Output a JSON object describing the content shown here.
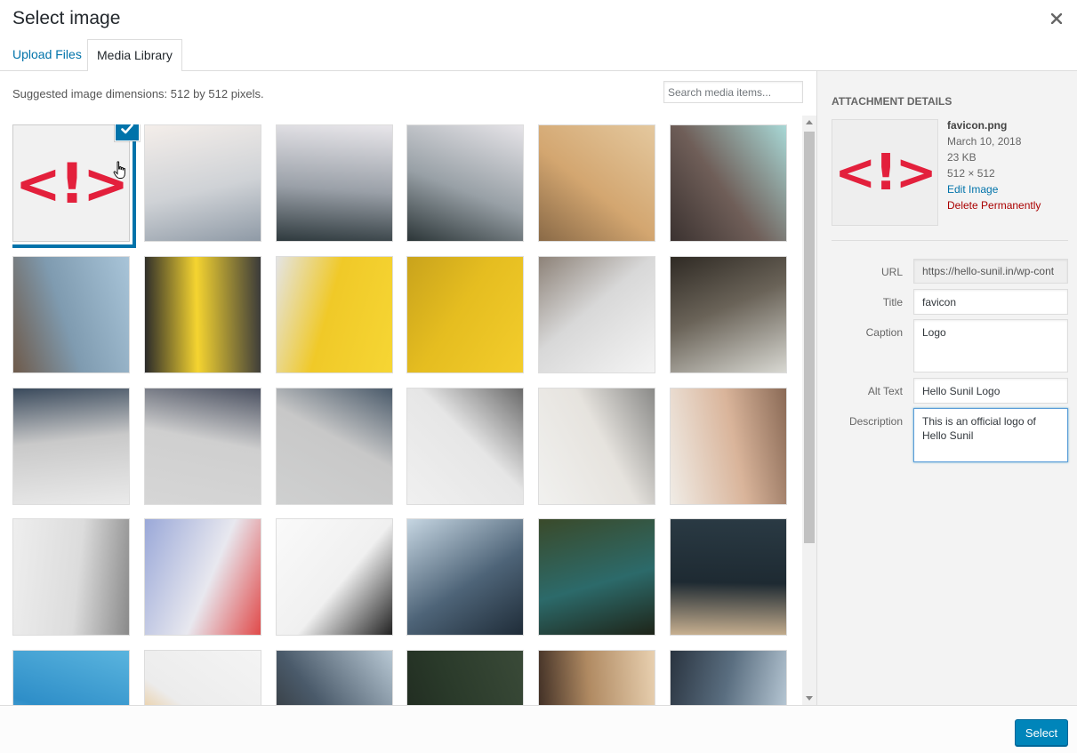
{
  "modal": {
    "title": "Select image",
    "close_label": "×"
  },
  "tabs": [
    {
      "label": "Upload Files",
      "active": false
    },
    {
      "label": "Media Library",
      "active": true
    }
  ],
  "toolbar": {
    "suggested": "Suggested image dimensions: 512 by 512 pixels.",
    "search_placeholder": "Search media items..."
  },
  "logo_text": "<!>",
  "grid": [
    {
      "name": "favicon-logo",
      "selected": true
    },
    {
      "name": "pen-paper",
      "colors": [
        "#f4eeea",
        "#cfd2d6",
        "#8f9aa6"
      ]
    },
    {
      "name": "misty-mountain-1",
      "colors": [
        "#e8e6ea",
        "#9aa0a8",
        "#2f3a3e"
      ]
    },
    {
      "name": "misty-mountain-2",
      "colors": [
        "#e6e4e8",
        "#98a0a6",
        "#2c3638"
      ]
    },
    {
      "name": "couple-bench",
      "colors": [
        "#e4c89e",
        "#d3a670",
        "#8a6a47"
      ]
    },
    {
      "name": "curved-building",
      "colors": [
        "#a8d8d6",
        "#6f5e58",
        "#3b3230"
      ]
    },
    {
      "name": "gillian-fog",
      "colors": [
        "#a8c4d8",
        "#7f9bb0",
        "#6e5a4a"
      ]
    },
    {
      "name": "mobile-screens",
      "colors": [
        "#3a3a3a",
        "#f5d430",
        "#2a2a2a"
      ]
    },
    {
      "name": "yellow-website",
      "colors": [
        "#f6d634",
        "#f0c928",
        "#e4e4e4"
      ]
    },
    {
      "name": "ribbons-buns",
      "colors": [
        "#f3cd2c",
        "#e5bd20",
        "#c9a31c"
      ]
    },
    {
      "name": "coins-jar",
      "colors": [
        "#f4f4f4",
        "#d8d8d8",
        "#8d8278"
      ]
    },
    {
      "name": "office-meeting",
      "colors": [
        "#d8d8d2",
        "#6a6358",
        "#2f2a24"
      ]
    },
    {
      "name": "smiling-man",
      "colors": [
        "#eaeaea",
        "#c9c9c9",
        "#3a4a5c"
      ]
    },
    {
      "name": "smiling-woman",
      "colors": [
        "#d6d6d6",
        "#cfcfcf",
        "#4a5060"
      ]
    },
    {
      "name": "bearded-man",
      "colors": [
        "#cfd0d0",
        "#c8c8c8",
        "#4a5a6a"
      ]
    },
    {
      "name": "phone-desk",
      "colors": [
        "#f0f0f0",
        "#e6e6e6",
        "#6a6a6a"
      ]
    },
    {
      "name": "white-room",
      "colors": [
        "#f1f1ef",
        "#e6e3de",
        "#8a8a88"
      ]
    },
    {
      "name": "workshop-table",
      "colors": [
        "#f0ece6",
        "#d9b49a",
        "#8a6a56"
      ]
    },
    {
      "name": "chairs-table",
      "colors": [
        "#eeeeee",
        "#dcdcdc",
        "#8a8a8a"
      ]
    },
    {
      "name": "stationery-mockup",
      "colors": [
        "#9aa8d8",
        "#e8e8ef",
        "#e04a4a"
      ]
    },
    {
      "name": "gillian-logos",
      "colors": [
        "#fafafa",
        "#f0f0f0",
        "#222222"
      ]
    },
    {
      "name": "city-buildings",
      "colors": [
        "#c6d6e2",
        "#4e6478",
        "#1f2c38"
      ]
    },
    {
      "name": "vintage-car",
      "colors": [
        "#3a4a2a",
        "#2c6a6a",
        "#1e2418"
      ]
    },
    {
      "name": "dark-food",
      "colors": [
        "#2a3a44",
        "#1e2a32",
        "#c8b090"
      ]
    },
    {
      "name": "blue-sky",
      "colors": [
        "#5ab4de",
        "#2e8ec8",
        "#a8d8f0"
      ]
    },
    {
      "name": "burger",
      "colors": [
        "#f4f4f4",
        "#ececec",
        "#e8a030"
      ]
    },
    {
      "name": "rocky-coast",
      "colors": [
        "#b8c8d4",
        "#4a5a6a",
        "#2a2a28"
      ]
    },
    {
      "name": "forest",
      "colors": [
        "#3a4a38",
        "#2a3a2a",
        "#1e281e"
      ]
    },
    {
      "name": "restaurant-glasses",
      "colors": [
        "#e8d0b0",
        "#b08a62",
        "#3a2a22"
      ]
    },
    {
      "name": "tall-buildings",
      "colors": [
        "#c8d8e4",
        "#5a6e80",
        "#2a3440"
      ]
    }
  ],
  "details": {
    "heading": "Attachment Details",
    "filename": "favicon.png",
    "date": "March 10, 2018",
    "size": "23 KB",
    "dimensions": "512 × 512",
    "edit_label": "Edit Image",
    "delete_label": "Delete Permanently",
    "url_label": "URL",
    "url_value": "https://hello-sunil.in/wp-cont",
    "title_label": "Title",
    "title_value": "favicon",
    "caption_label": "Caption",
    "caption_value": "Logo",
    "alt_label": "Alt Text",
    "alt_value": "Hello Sunil Logo",
    "description_label": "Description",
    "description_value": "This is an official logo of Hello Sunil"
  },
  "footer": {
    "select_label": "Select"
  },
  "colors": {
    "accent": "#0073aa",
    "primary_button": "#0085ba",
    "danger": "#a00",
    "logo_red": "#e3203c"
  }
}
